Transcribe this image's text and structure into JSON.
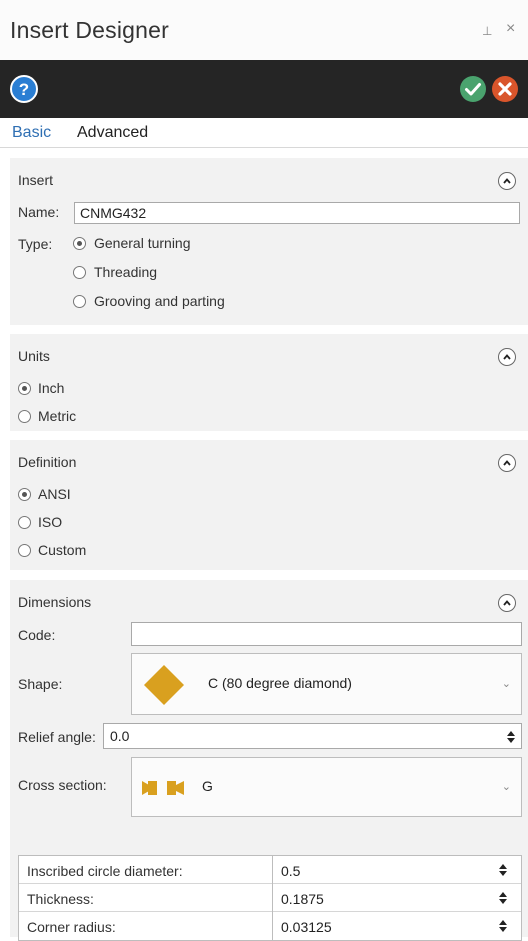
{
  "window": {
    "title": "Insert Designer",
    "pin_glyph": "⊥",
    "close_glyph": "×"
  },
  "toolbar": {
    "help_icon": "help-circle-icon",
    "ok_icon": "check-circle-icon",
    "cancel_icon": "cancel-circle-icon",
    "colors": {
      "bg": "#252525",
      "help": "#2a7ed3",
      "ok": "#4aa36e",
      "cancel": "#d9552b"
    }
  },
  "tabs": [
    {
      "label": "Basic",
      "active": true
    },
    {
      "label": "Advanced",
      "active": false
    }
  ],
  "insert": {
    "title": "Insert",
    "name_label": "Name:",
    "name_value": "CNMG432",
    "type_label": "Type:",
    "types": [
      {
        "label": "General turning",
        "selected": true
      },
      {
        "label": "Threading",
        "selected": false
      },
      {
        "label": "Grooving and parting",
        "selected": false
      }
    ]
  },
  "units": {
    "title": "Units",
    "options": [
      {
        "label": "Inch",
        "selected": true
      },
      {
        "label": "Metric",
        "selected": false
      }
    ]
  },
  "definition": {
    "title": "Definition",
    "options": [
      {
        "label": "ANSI",
        "selected": true
      },
      {
        "label": "ISO",
        "selected": false
      },
      {
        "label": "Custom",
        "selected": false
      }
    ]
  },
  "dimensions": {
    "title": "Dimensions",
    "code_label": "Code:",
    "code_value": "",
    "shape_label": "Shape:",
    "shape_value": "C (80 degree diamond)",
    "shape_icon": "diamond-shape-icon",
    "relief_label": "Relief angle:",
    "relief_value": "0.0",
    "cross_label": "Cross section:",
    "cross_value": "G",
    "cross_icon": "cross-section-icon",
    "accent": "#d9a01f",
    "rows": [
      {
        "label": "Inscribed circle diameter:",
        "value": "0.5"
      },
      {
        "label": "Thickness:",
        "value": "0.1875"
      },
      {
        "label": "Corner radius:",
        "value": "0.03125"
      }
    ]
  }
}
